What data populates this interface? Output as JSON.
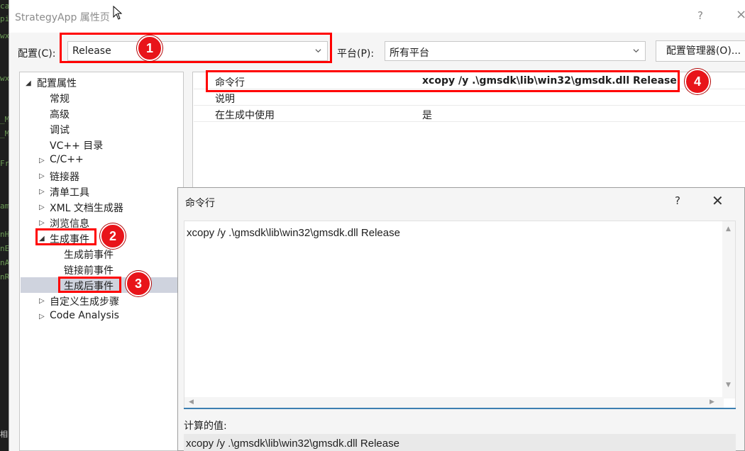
{
  "window": {
    "title": "StrategyApp 属性页",
    "help_glyph": "?",
    "close_glyph": "×"
  },
  "config": {
    "label": "配置(C):",
    "value": "Release",
    "platform_label": "平台(P):",
    "platform_value": "所有平台",
    "manager_button": "配置管理器(O)..."
  },
  "tree": {
    "root": "配置属性",
    "items": [
      {
        "label": "常规"
      },
      {
        "label": "高级"
      },
      {
        "label": "调试"
      },
      {
        "label": "VC++ 目录"
      },
      {
        "label": "C/C++"
      },
      {
        "label": "链接器"
      },
      {
        "label": "清单工具"
      },
      {
        "label": "XML 文档生成器"
      },
      {
        "label": "浏览信息"
      },
      {
        "label": "生成事件"
      },
      {
        "label": "生成前事件"
      },
      {
        "label": "链接前事件"
      },
      {
        "label": "生成后事件"
      },
      {
        "label": "自定义生成步骤"
      },
      {
        "label": "Code Analysis"
      }
    ]
  },
  "grid": {
    "rows": [
      {
        "key": "命令行",
        "value": "xcopy /y .\\gmsdk\\lib\\win32\\gmsdk.dll Release"
      },
      {
        "key": "说明",
        "value": ""
      },
      {
        "key": "在生成中使用",
        "value": "是"
      }
    ]
  },
  "annotations": {
    "badges": [
      "1",
      "2",
      "3",
      "4"
    ],
    "color": "#ff0000"
  },
  "dialog": {
    "title": "命令行",
    "help_glyph": "?",
    "close_glyph": "✕",
    "command_text": "xcopy /y .\\gmsdk\\lib\\win32\\gmsdk.dll Release",
    "computed_label": "计算的值:",
    "computed_value": "xcopy /y .\\gmsdk\\lib\\win32\\gmsdk.dll Release"
  },
  "colors": {
    "selection": "#cfd3de",
    "accent_underline": "#3c7fb1"
  }
}
